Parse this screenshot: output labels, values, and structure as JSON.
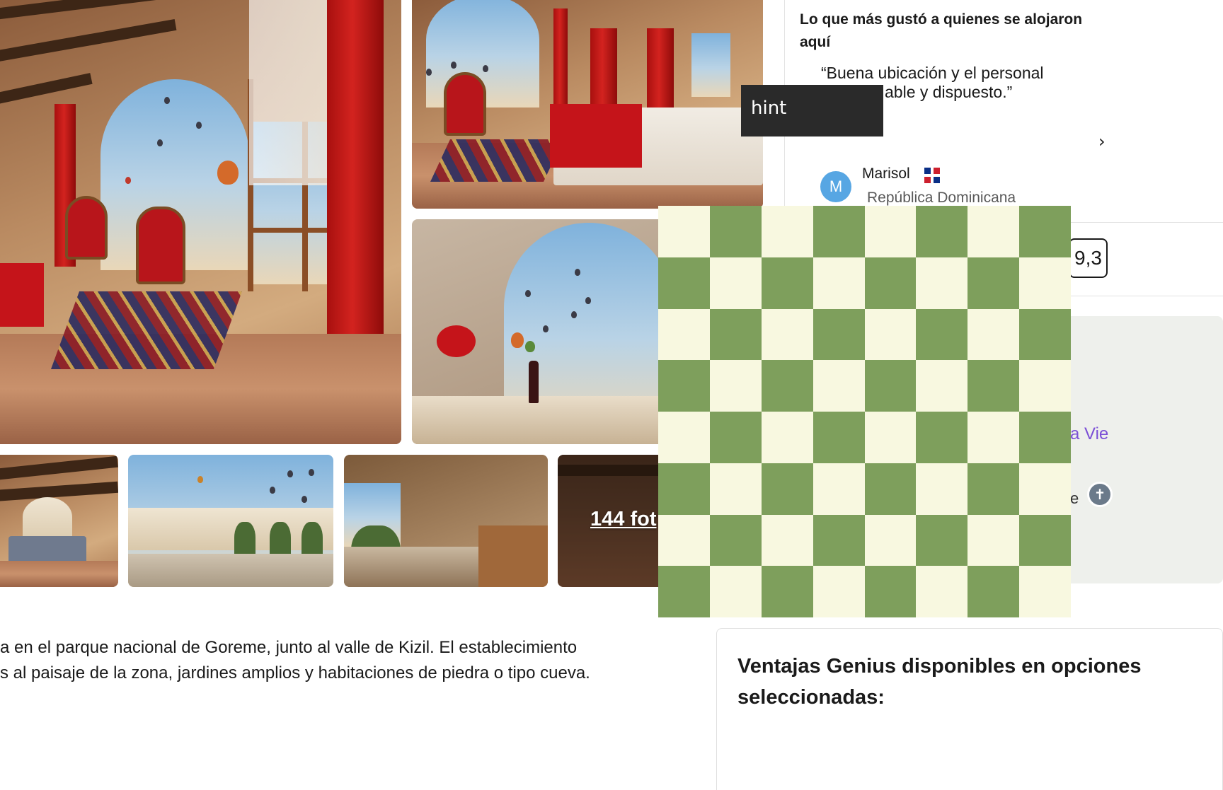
{
  "gallery": {
    "more_photos_label": "144 fot"
  },
  "description": {
    "line1": "a en el parque nacional de Goreme, junto al valle de Kizil. El establecimiento",
    "line2": "s al paisaje de la zona, jardines amplios y habitaciones de piedra o tipo cueva."
  },
  "reviews": {
    "heading": "Lo que más gustó a quienes se alojaron aquí",
    "quote_line1": "“Buena ubicación y el personal",
    "quote_line2": "able y dispuesto.”",
    "next_icon": "chevron-right-icon",
    "reviewer_initial": "M",
    "reviewer_name": "Marisol",
    "reviewer_country": "República Dominicana",
    "flag_icon": "dominican-republic-flag-icon",
    "score": "9,3"
  },
  "map": {
    "place_label": "a Vie",
    "side_label": "e",
    "pin_icon": "cross-pin-icon"
  },
  "genius": {
    "title": "Ventajas Genius disponibles en opciones seleccionadas:"
  },
  "tooltip": {
    "text": "hint"
  },
  "chessboard": {
    "rows": 8,
    "cols": 8,
    "light_color": "#f8f8e0",
    "dark_color": "#7e9f5c"
  },
  "colors": {
    "text": "#1a1a1a",
    "muted": "#595959",
    "avatar": "#57a6e3",
    "map_label": "#7b4fd6",
    "tooltip_bg": "#2a2a2a"
  }
}
